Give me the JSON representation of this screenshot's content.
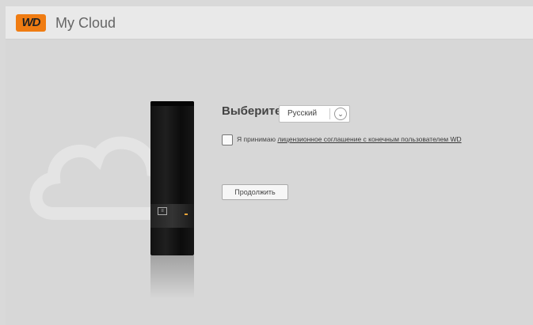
{
  "header": {
    "logo_text": "WD",
    "app_title": "My Cloud"
  },
  "language": {
    "label": "Выберите я:",
    "selected": "Русский"
  },
  "eula": {
    "prefix": "Я принимаю ",
    "link_text": "лицензионное соглашение с конечным пользователем WD"
  },
  "actions": {
    "continue_label": "Продолжить"
  },
  "device": {
    "badge_text": "≡"
  },
  "colors": {
    "brand_orange": "#f07c12",
    "background": "#d7d7d7",
    "topbar": "#e9e9e9"
  }
}
